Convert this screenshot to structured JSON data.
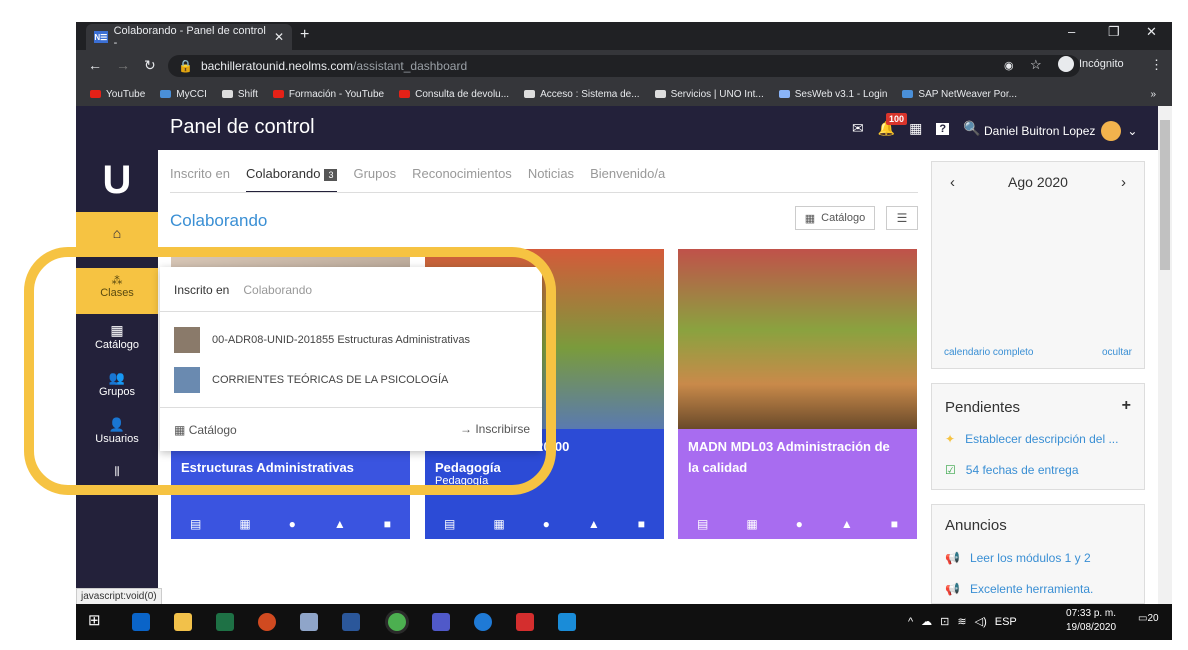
{
  "browser": {
    "tab_title": "Colaborando - Panel de control -",
    "favicon_text": "N☰",
    "url_host": "bachilleratounid.neolms.com",
    "url_path": "/assistant_dashboard",
    "incognito_label": "Incógnito",
    "bookmarks": [
      {
        "label": "YouTube",
        "color": "#e62117"
      },
      {
        "label": "MyCCI",
        "color": "#4a8fd8"
      },
      {
        "label": "Shift",
        "color": "#dddddd"
      },
      {
        "label": "Formación - YouTube",
        "color": "#e62117"
      },
      {
        "label": "Consulta de devolu...",
        "color": "#e62117"
      },
      {
        "label": "Acceso : Sistema de...",
        "color": "#dddddd"
      },
      {
        "label": "Servicios | UNO Int...",
        "color": "#dddddd"
      },
      {
        "label": "SesWeb v3.1 - Login",
        "color": "#8ab4f8"
      },
      {
        "label": "SAP NetWeaver Por...",
        "color": "#4a8fd8"
      }
    ],
    "bookmarks_more": "»"
  },
  "app": {
    "page_title": "Panel de control",
    "notif_count": "100",
    "user_name": "Daniel Buitron Lopez",
    "logo": "U",
    "sidebar": [
      {
        "label": "Clases"
      },
      {
        "label": "Catálogo"
      },
      {
        "label": "Grupos"
      },
      {
        "label": "Usuarios"
      }
    ]
  },
  "main": {
    "tabs": [
      "Inscrito en",
      "Colaborando",
      "Grupos",
      "Reconocimientos",
      "Noticias",
      "Bienvenido/a"
    ],
    "tab_count": "3",
    "heading": "Colaborando",
    "catalog_btn": "Catálogo",
    "cards": [
      {
        "line1": "00-ADR08-UNID-201855",
        "line2": "Estructuras Administrativas",
        "color": "#3a54e0"
      },
      {
        "line1": "EEEB UNID-DIS-20-00",
        "line2": "Pedagogía",
        "line3": "Pedagogía",
        "color": "#2c4bd6"
      },
      {
        "line1": "MADN MDL03 Administración de",
        "line2": "la calidad",
        "color": "#a86cf0"
      }
    ]
  },
  "calendar": {
    "month": "Ago 2020",
    "full_link": "calendario completo",
    "hide_link": "ocultar"
  },
  "pendientes": {
    "title": "Pendientes",
    "items": [
      "Establecer descripción del ...",
      "54 fechas de entrega"
    ]
  },
  "anuncios": {
    "title": "Anuncios",
    "items": [
      "Leer los módulos 1 y 2",
      "Excelente herramienta."
    ]
  },
  "popup": {
    "tabs": [
      "Inscrito en",
      "Colaborando"
    ],
    "items": [
      "00-ADR08-UNID-201855 Estructuras Administrativas",
      "CORRIENTES TEÓRICAS DE LA PSICOLOGÍA"
    ],
    "catalog": "Catálogo",
    "enroll": "Inscribirse"
  },
  "status_bar": "javascript:void(0)",
  "taskbar": {
    "lang": "ESP",
    "time": "07:33 p. m.",
    "date": "19/08/2020",
    "notif": "20"
  }
}
